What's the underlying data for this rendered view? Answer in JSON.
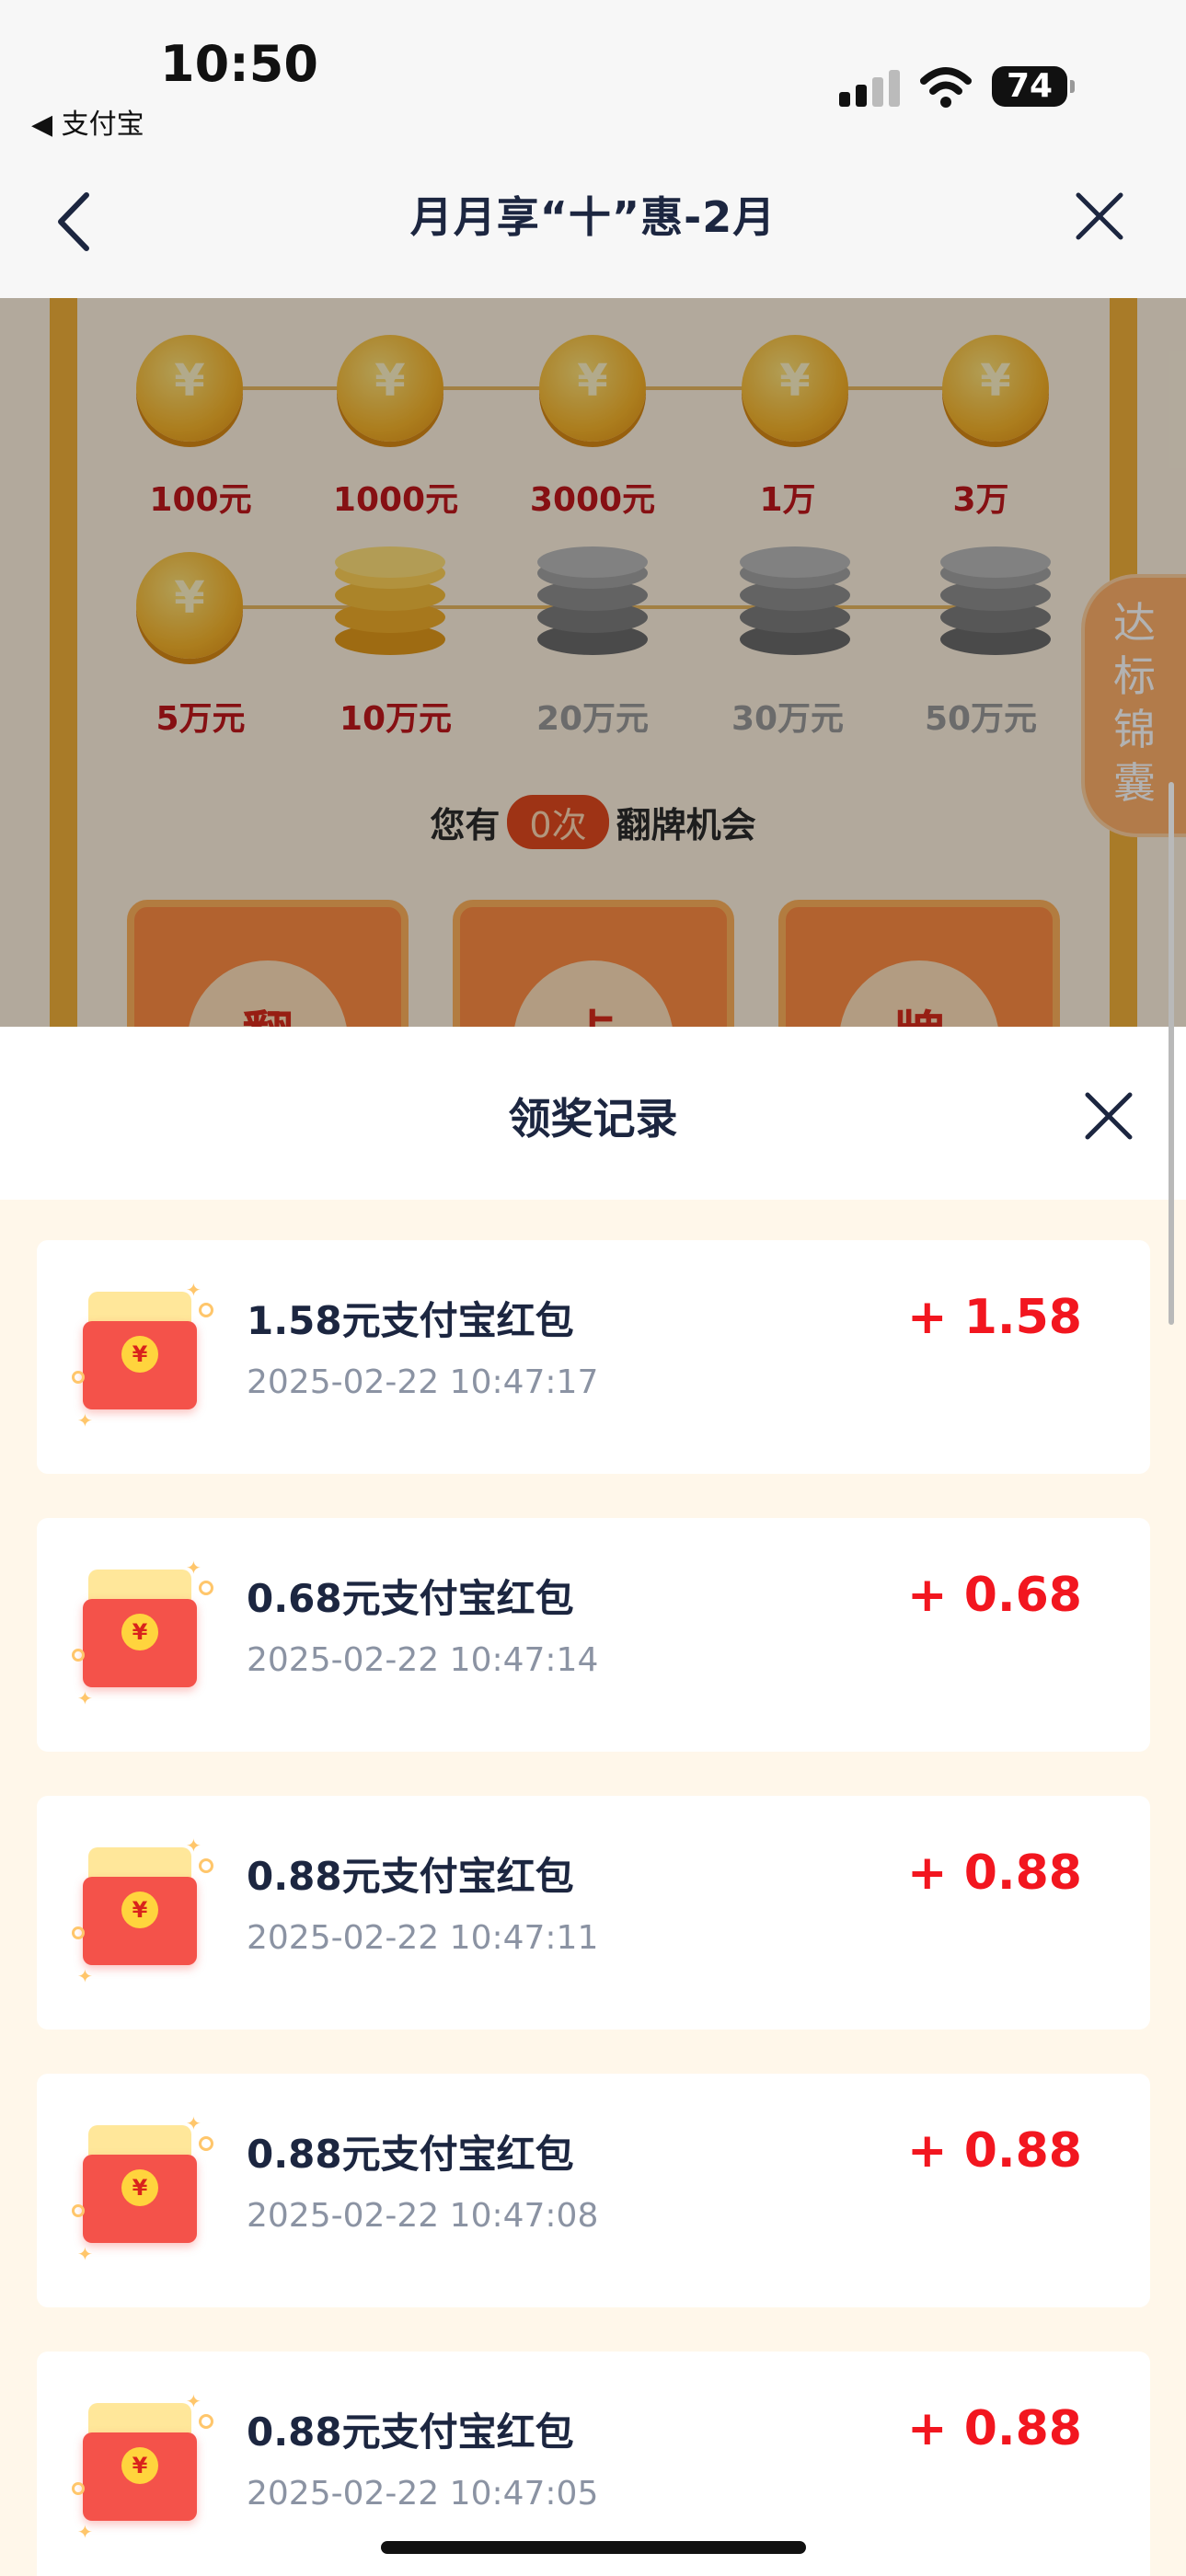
{
  "status_bar": {
    "time": "10:50",
    "back_app": "◀ 支付宝",
    "battery": "74"
  },
  "nav": {
    "title": "月月享“十”惠-2月"
  },
  "background": {
    "milestones_row1": [
      "100元",
      "1000元",
      "3000元",
      "1万",
      "3万"
    ],
    "milestones_row2": [
      "5万元",
      "10万元",
      "20万元",
      "30万元",
      "50万元"
    ],
    "chance_prefix": "您有",
    "chance_count": "0次",
    "chance_suffix": "翻牌机会",
    "cards": [
      "翻",
      "卡",
      "牌"
    ],
    "side_tab": "达标锦囊"
  },
  "sheet": {
    "title": "领奖记录",
    "records": [
      {
        "title": "1.58元支付宝红包",
        "time": "2025-02-22 10:47:17",
        "amount": "+ 1.58"
      },
      {
        "title": "0.68元支付宝红包",
        "time": "2025-02-22 10:47:14",
        "amount": "+ 0.68"
      },
      {
        "title": "0.88元支付宝红包",
        "time": "2025-02-22 10:47:11",
        "amount": "+ 0.88"
      },
      {
        "title": "0.88元支付宝红包",
        "time": "2025-02-22 10:47:08",
        "amount": "+ 0.88"
      },
      {
        "title": "0.88元支付宝红包",
        "time": "2025-02-22 10:47:05",
        "amount": "+ 0.88"
      }
    ]
  },
  "colors": {
    "accent_red": "#f2161f",
    "title_navy": "#1c2640",
    "sheet_bg": "#fff7ea"
  }
}
